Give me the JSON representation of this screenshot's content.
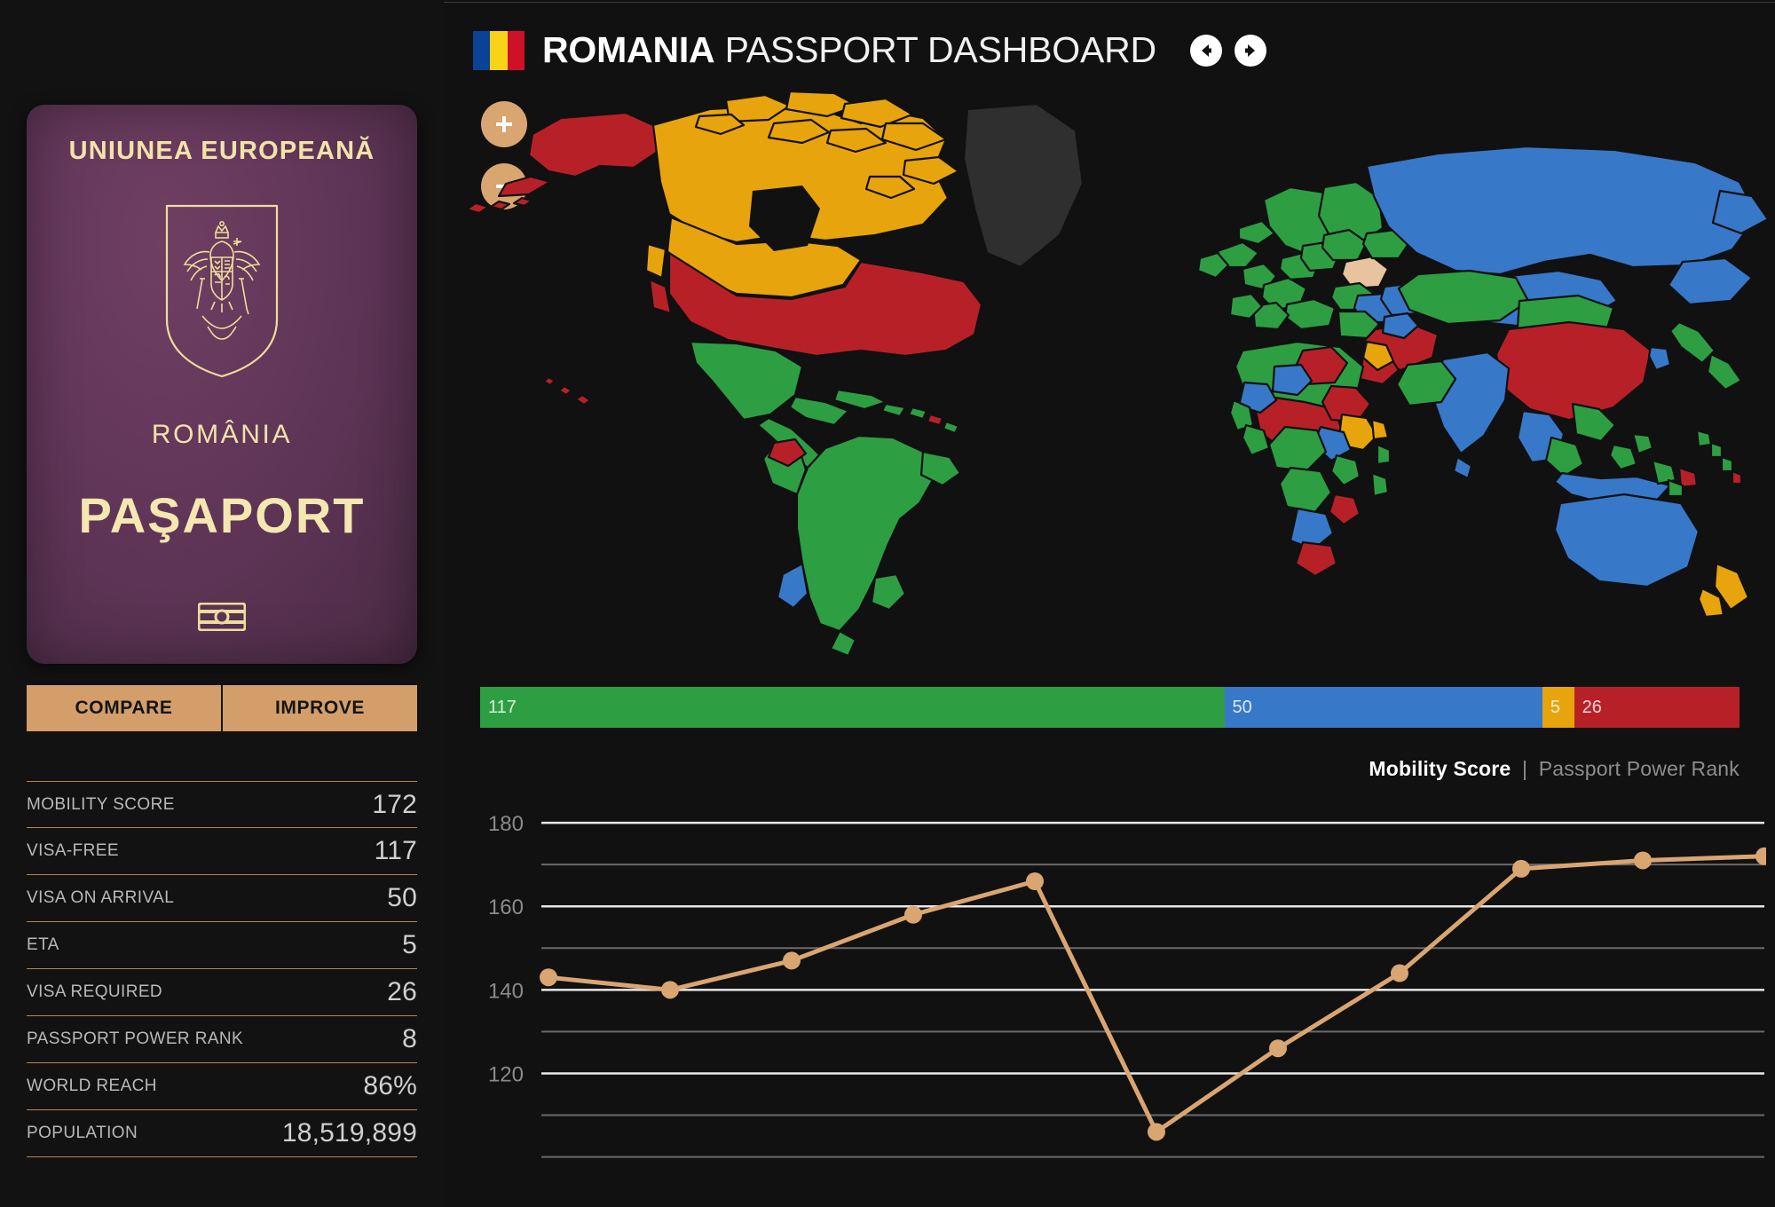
{
  "header": {
    "country": "ROMANIA",
    "subtitle": " PASSPORT DASHBOARD",
    "flag_colors": [
      "#0a4296",
      "#f7d417",
      "#ce1126"
    ],
    "prev_icon": "arrow-left-circle-icon",
    "next_icon": "arrow-right-circle-icon"
  },
  "passport": {
    "union_line": "UNIUNEA EUROPEANĂ",
    "country_line": "ROMÂNIA",
    "document_word": "PAŞAPORT",
    "crest_icon": "romania-coat-of-arms-icon",
    "chip_icon": "biometric-chip-icon",
    "cover_color": "#5b3352",
    "foil_color": "#f2e3a8"
  },
  "actions": {
    "compare_label": "COMPARE",
    "improve_label": "IMPROVE",
    "button_color": "#d49e6a"
  },
  "stats": [
    {
      "label": "MOBILITY SCORE",
      "value": "172"
    },
    {
      "label": "VISA-FREE",
      "value": "117"
    },
    {
      "label": "VISA ON ARRIVAL",
      "value": "50"
    },
    {
      "label": "ETA",
      "value": "5"
    },
    {
      "label": "VISA REQUIRED",
      "value": "26"
    },
    {
      "label": "PASSPORT POWER RANK",
      "value": "8"
    },
    {
      "label": "WORLD REACH",
      "value": "86%"
    },
    {
      "label": "POPULATION",
      "value": "18,519,899"
    }
  ],
  "map": {
    "zoom_in_label": "+",
    "zoom_out_label": "−",
    "zoom_in_icon": "plus-icon",
    "zoom_out_icon": "minus-icon",
    "colors": {
      "visa_free": "#2e9e43",
      "visa_on_arrival": "#3878c8",
      "eta": "#e8a40c",
      "visa_required": "#b82028",
      "no_data": "#2f2f2f",
      "home": "#e8c3a0",
      "ocean": "#111111"
    }
  },
  "legend_bar": [
    {
      "label": "117",
      "value": 117,
      "color": "#2e9e43",
      "text_color": "#dff0d8",
      "category": "visa-free"
    },
    {
      "label": "50",
      "value": 50,
      "color": "#3878c8",
      "text_color": "#dce9f8",
      "category": "visa-on-arrival"
    },
    {
      "label": "5",
      "value": 5,
      "color": "#e8a40c",
      "text_color": "#fff4d6",
      "category": "eta"
    },
    {
      "label": "26",
      "value": 26,
      "color": "#b82028",
      "text_color": "#f6d7d8",
      "category": "visa-required"
    }
  ],
  "chart_legend": {
    "active": "Mobility Score",
    "separator": "|",
    "inactive": "Passport Power Rank"
  },
  "chart_data": {
    "type": "line",
    "title": "",
    "xlabel": "",
    "ylabel": "",
    "series": [
      {
        "name": "Mobility Score",
        "color": "#d9a571",
        "values": [
          143,
          140,
          147,
          158,
          166,
          106,
          126,
          144,
          169,
          171,
          172
        ]
      }
    ],
    "x": [
      1,
      2,
      3,
      4,
      5,
      6,
      7,
      8,
      9,
      10,
      11
    ],
    "yticks": [
      180,
      160,
      140,
      120
    ],
    "ylim": [
      98,
      183
    ],
    "grid": true,
    "gridline_step": 10,
    "legend_position": "top-right"
  }
}
